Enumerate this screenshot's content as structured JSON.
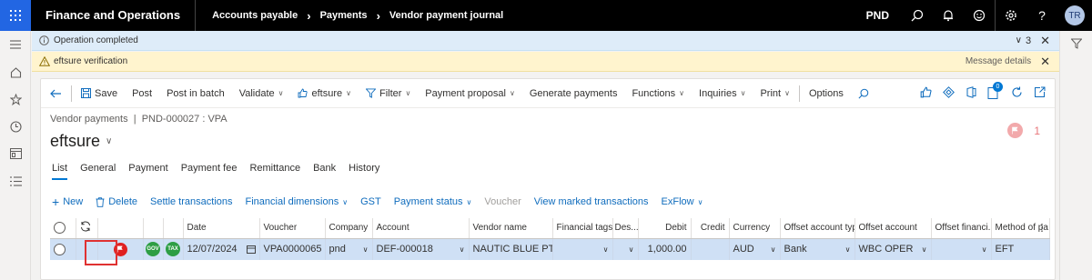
{
  "topbar": {
    "app_title": "Finance and Operations",
    "breadcrumbs": [
      "Accounts payable",
      "Payments",
      "Vendor payment journal"
    ],
    "company": "PND",
    "user_initials": "TR"
  },
  "messages": {
    "info_text": "Operation completed",
    "info_count": "3",
    "warning_text": "eftsure verification",
    "warning_link": "Message details"
  },
  "action_pane": {
    "save": "Save",
    "post": "Post",
    "post_in_batch": "Post in batch",
    "validate": "Validate",
    "eftsure": "eftsure",
    "filter": "Filter",
    "payment_proposal": "Payment proposal",
    "generate_payments": "Generate payments",
    "functions": "Functions",
    "inquiries": "Inquiries",
    "print": "Print",
    "options": "Options",
    "notification_count": "0"
  },
  "page": {
    "breadcrumb": "Vendor payments  |  PND-000027 : VPA",
    "title": "eftsure",
    "flag_count": "1"
  },
  "tabs": [
    "List",
    "General",
    "Payment",
    "Payment fee",
    "Remittance",
    "Bank",
    "History"
  ],
  "grid_actions": {
    "new": "New",
    "delete": "Delete",
    "settle": "Settle transactions",
    "financial_dimensions": "Financial dimensions",
    "gst": "GST",
    "payment_status": "Payment status",
    "voucher": "Voucher",
    "view_marked": "View marked transactions",
    "exflow": "ExFlow"
  },
  "grid": {
    "headers": {
      "date": "Date",
      "voucher": "Voucher",
      "company": "Company",
      "account": "Account",
      "vendor_name": "Vendor name",
      "financial_tags": "Financial tags",
      "description": "Des...",
      "debit": "Debit",
      "credit": "Credit",
      "currency": "Currency",
      "offset_account_type": "Offset account type",
      "offset_account": "Offset account",
      "offset_financial": "Offset financi...",
      "method_of_payment": "Method of pa"
    },
    "row": {
      "gov": "GOV",
      "tax": "TAX",
      "date": "12/07/2024",
      "voucher": "VPA0000065",
      "company": "pnd",
      "account": "DEF-000018",
      "vendor_name": "NAUTIC BLUE PT...",
      "financial_tags": "",
      "description": "",
      "debit": "1,000.00",
      "credit": "",
      "currency": "AUD",
      "offset_account_type": "Bank",
      "offset_account": "WBC OPER",
      "offset_financial": "",
      "method_of_payment": "EFT"
    }
  },
  "colors": {
    "accent": "#0078d4",
    "flag_red": "#e02020",
    "status_green": "#2e9e44",
    "selected_row": "#cfe0f5"
  }
}
